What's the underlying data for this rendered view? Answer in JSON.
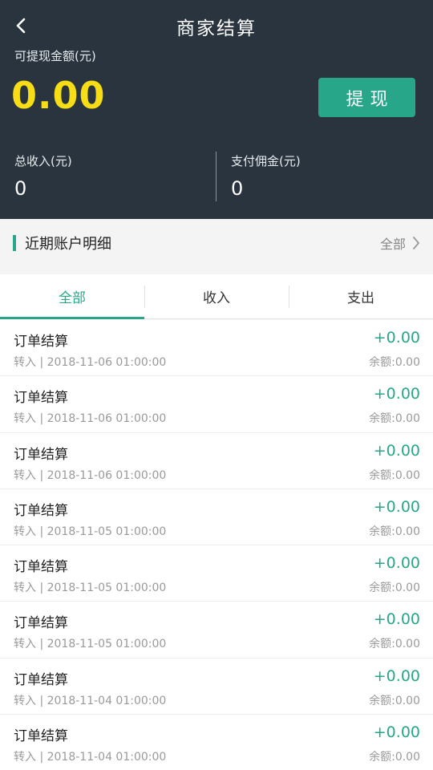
{
  "header": {
    "title": "商家结算",
    "available_label": "可提现金额(元)",
    "available_amount": "0.00",
    "withdraw_label": "提现",
    "total_income_label": "总收入(元)",
    "total_income_value": "0",
    "commission_label": "支付佣金(元)",
    "commission_value": "0"
  },
  "section": {
    "title": "近期账户明细",
    "all_label": "全部"
  },
  "tabs": [
    {
      "label": "全部",
      "active": true
    },
    {
      "label": "收入",
      "active": false
    },
    {
      "label": "支出",
      "active": false
    }
  ],
  "records": [
    {
      "title": "订单结算",
      "detail": "转入 | 2018-11-06 01:00:00",
      "amount": "+0.00",
      "balance": "余额:0.00"
    },
    {
      "title": "订单结算",
      "detail": "转入 | 2018-11-06 01:00:00",
      "amount": "+0.00",
      "balance": "余额:0.00"
    },
    {
      "title": "订单结算",
      "detail": "转入 | 2018-11-06 01:00:00",
      "amount": "+0.00",
      "balance": "余额:0.00"
    },
    {
      "title": "订单结算",
      "detail": "转入 | 2018-11-05 01:00:00",
      "amount": "+0.00",
      "balance": "余额:0.00"
    },
    {
      "title": "订单结算",
      "detail": "转入 | 2018-11-05 01:00:00",
      "amount": "+0.00",
      "balance": "余额:0.00"
    },
    {
      "title": "订单结算",
      "detail": "转入 | 2018-11-05 01:00:00",
      "amount": "+0.00",
      "balance": "余额:0.00"
    },
    {
      "title": "订单结算",
      "detail": "转入 | 2018-11-04 01:00:00",
      "amount": "+0.00",
      "balance": "余额:0.00"
    },
    {
      "title": "订单结算",
      "detail": "转入 | 2018-11-04 01:00:00",
      "amount": "+0.00",
      "balance": "余额:0.00"
    }
  ],
  "colors": {
    "header_bg": "#2a343e",
    "accent": "#27a68a",
    "amount_yellow": "#f6dd16"
  },
  "icons": {
    "back": "chevron-left-icon",
    "more": "chevron-right-icon"
  }
}
